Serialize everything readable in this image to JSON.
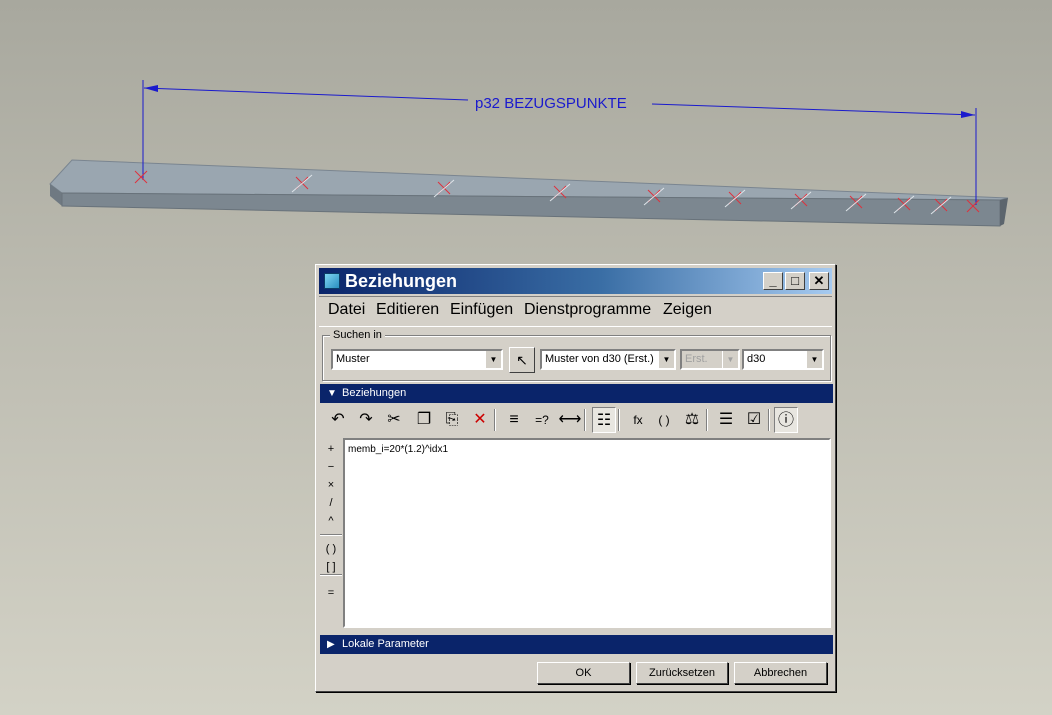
{
  "viewport": {
    "dimension_label": "p32 BEZUGSPUNKTE",
    "colors": {
      "dimension": "#1a1acd",
      "datum_marker": "#e0303c",
      "part_top": "#9aa6b0",
      "part_side": "#6f7982"
    }
  },
  "dialog": {
    "title": "Beziehungen",
    "controls": {
      "minimize": "_",
      "maximize": "□",
      "close": "✕"
    },
    "menu": [
      "Datei",
      "Editieren",
      "Einfügen",
      "Dienstprogramme",
      "Zeigen"
    ],
    "search": {
      "group_label": "Suchen in",
      "type_combo": "Muster",
      "select_icon": "arrow-cursor-icon",
      "target_combo": "Muster von d30 (Erst.) ·",
      "mode_combo": "Erst.",
      "dim_combo": "d30"
    },
    "relations_header": "Beziehungen",
    "toolbar": [
      {
        "name": "undo-icon",
        "glyph": "↶"
      },
      {
        "name": "redo-icon",
        "glyph": "↷"
      },
      {
        "name": "cut-icon",
        "glyph": "✂"
      },
      {
        "name": "copy-icon",
        "glyph": "❐"
      },
      {
        "name": "paste-icon",
        "glyph": "⎘"
      },
      {
        "name": "delete-icon",
        "glyph": "✕"
      },
      {
        "name": "switch-dimensions-icon",
        "glyph": "≡"
      },
      {
        "name": "evaluate-icon",
        "glyph": "=?"
      },
      {
        "name": "display-dimension-icon",
        "glyph": "⟷"
      },
      {
        "name": "sort-relations-icon",
        "glyph": "☷"
      },
      {
        "name": "insert-function-icon",
        "glyph": "fx"
      },
      {
        "name": "insert-parameter-icon",
        "glyph": "( )"
      },
      {
        "name": "insert-unit-icon",
        "glyph": "⚖"
      },
      {
        "name": "local-parameters-icon",
        "glyph": "☰"
      },
      {
        "name": "verify-relations-icon",
        "glyph": "☑"
      },
      {
        "name": "info-icon",
        "glyph": "ⓘ"
      }
    ],
    "operators": [
      "+",
      "−",
      "×",
      "/",
      "^",
      "( )",
      "[ ]",
      "="
    ],
    "relation_text": "memb_i=20*(1.2)^idx1",
    "local_params_header": "Lokale Parameter",
    "buttons": {
      "ok": "OK",
      "reset": "Zurücksetzen",
      "cancel": "Abbrechen"
    },
    "colors": {
      "title_start": "#0a246a",
      "title_end": "#a6caf0",
      "header_bar": "#0a246a",
      "delete_icon": "#cc0000"
    }
  }
}
